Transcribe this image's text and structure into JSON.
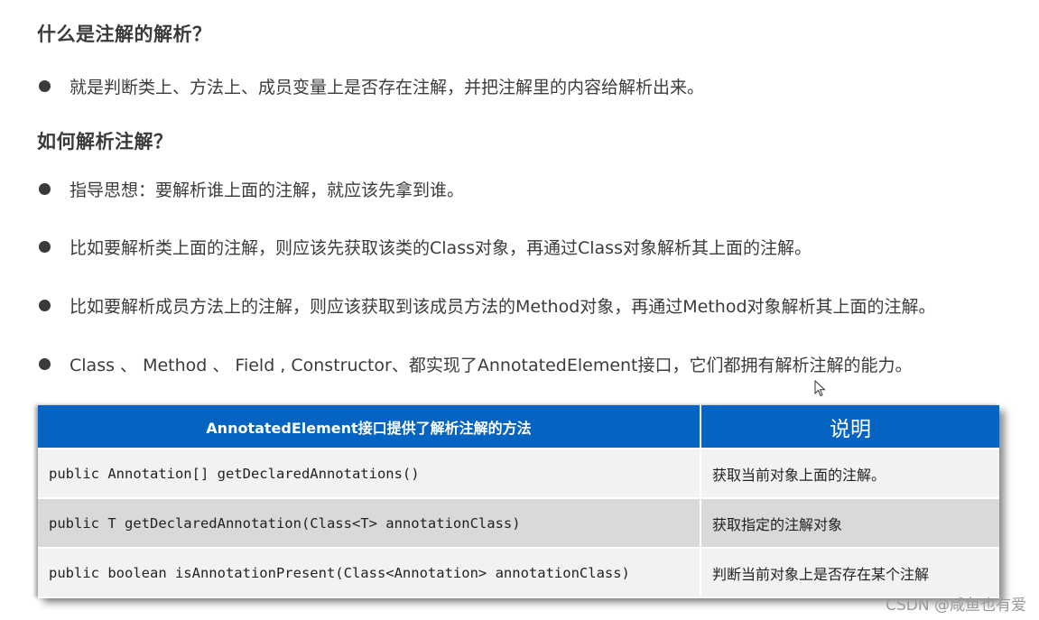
{
  "sections": [
    {
      "heading": "什么是注解的解析？",
      "bullets": [
        "就是判断类上、方法上、成员变量上是否存在注解，并把注解里的内容给解析出来。"
      ]
    },
    {
      "heading": "如何解析注解？",
      "bullets": [
        "指导思想：要解析谁上面的注解，就应该先拿到谁。",
        "比如要解析类上面的注解，则应该先获取该类的Class对象，再通过Class对象解析其上面的注解。",
        "比如要解析成员方法上的注解，则应该获取到该成员方法的Method对象，再通过Method对象解析其上面的注解。",
        "Class 、 Method 、 Field , Constructor、都实现了AnnotatedElement接口，它们都拥有解析注解的能力。"
      ]
    }
  ],
  "table": {
    "headers": [
      "AnnotatedElement接口提供了解析注解的方法",
      "说明"
    ],
    "rows": [
      [
        "public Annotation[] getDeclaredAnnotations()",
        "获取当前对象上面的注解。"
      ],
      [
        "public T getDeclaredAnnotation(Class<T> annotationClass)",
        "获取指定的注解对象"
      ],
      [
        "public boolean isAnnotationPresent(Class<Annotation> annotationClass)",
        "判断当前对象上是否存在某个注解"
      ]
    ],
    "colors": {
      "header_bg": "#0563c1",
      "row_light": "#f2f2f2",
      "row_dark": "#d9d9d9"
    }
  },
  "watermark": "CSDN @咸鱼也有爱",
  "icons": {
    "cursor": "mouse-pointer-icon",
    "bullet": "bullet-dot-icon"
  }
}
